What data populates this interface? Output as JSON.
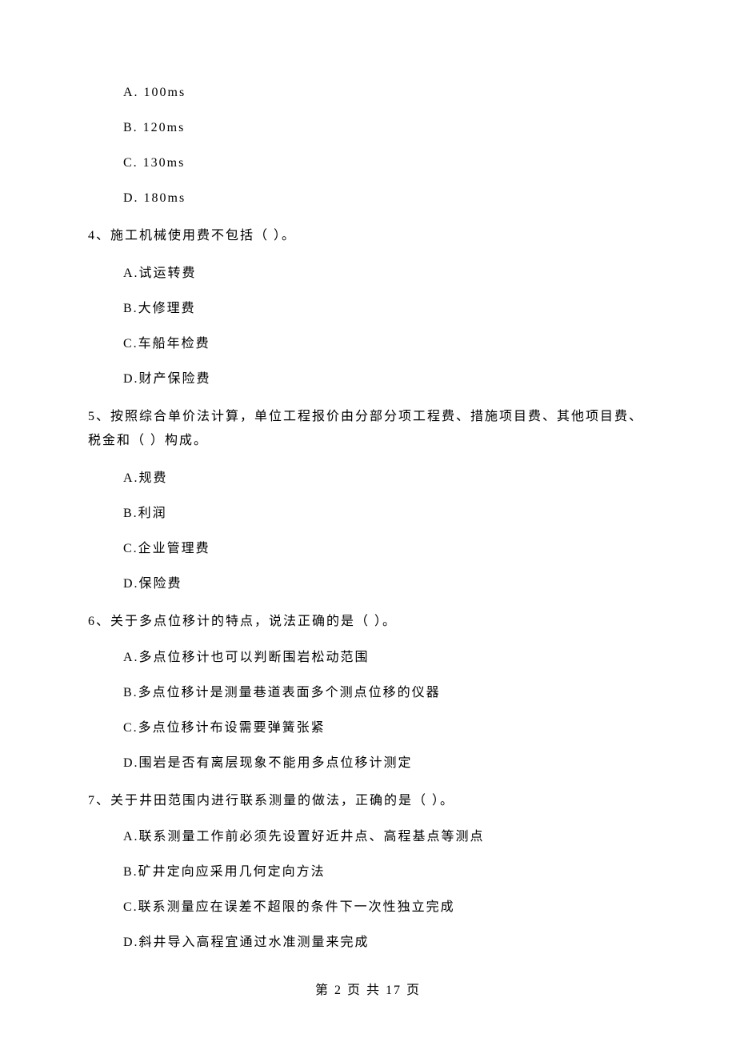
{
  "prev_question_tail": {
    "options": [
      "A.  100ms",
      "B.  120ms",
      "C.  130ms",
      "D.  180ms"
    ]
  },
  "questions": [
    {
      "number": "4、",
      "stem": "施工机械使用费不包括（    ）。",
      "options": [
        "A.试运转费",
        "B.大修理费",
        "C.车船年检费",
        "D.财产保险费"
      ]
    },
    {
      "number": "5、",
      "stem": "按照综合单价法计算，单位工程报价由分部分项工程费、措施项目费、其他项目费、税金和（    ）构成。",
      "options": [
        "A.规费",
        "B.利润",
        "C.企业管理费",
        "D.保险费"
      ]
    },
    {
      "number": "6、",
      "stem": "关于多点位移计的特点，说法正确的是（    ）。",
      "options": [
        "A.多点位移计也可以判断围岩松动范围",
        "B.多点位移计是测量巷道表面多个测点位移的仪器",
        "C.多点位移计布设需要弹簧张紧",
        "D.围岩是否有离层现象不能用多点位移计测定"
      ]
    },
    {
      "number": "7、",
      "stem": "关于井田范围内进行联系测量的做法，正确的是（    ）。",
      "options": [
        "A.联系测量工作前必须先设置好近井点、高程基点等测点",
        "B.矿井定向应采用几何定向方法",
        "C.联系测量应在误差不超限的条件下一次性独立完成",
        "D.斜井导入高程宜通过水准测量来完成"
      ]
    }
  ],
  "footer": "第 2 页 共 17 页"
}
